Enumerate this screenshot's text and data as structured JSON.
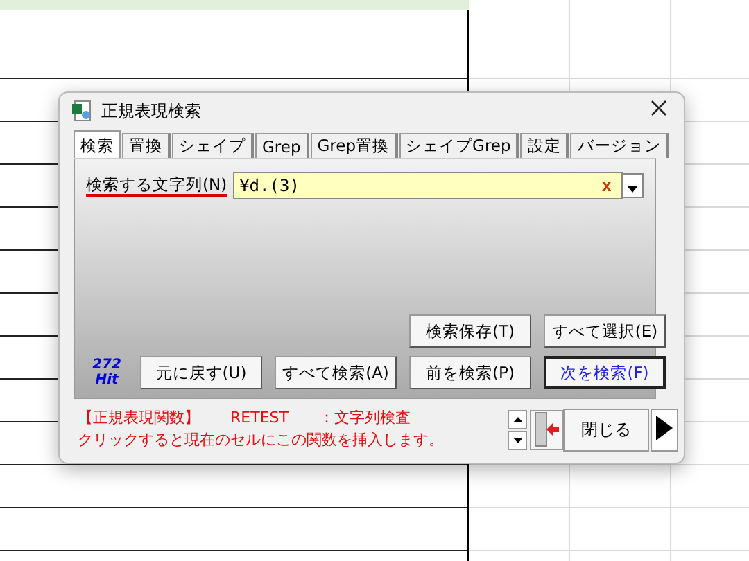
{
  "window": {
    "title": "正規表現検索"
  },
  "tabs": [
    {
      "label": "検索",
      "selected": true
    },
    {
      "label": "置換",
      "selected": false
    },
    {
      "label": "シェイプ",
      "selected": false
    },
    {
      "label": "Grep",
      "selected": false
    },
    {
      "label": "Grep置換",
      "selected": false
    },
    {
      "label": "シェイプGrep",
      "selected": false
    },
    {
      "label": "設定",
      "selected": false
    },
    {
      "label": "バージョン",
      "selected": false
    }
  ],
  "search": {
    "label": "検索する文字列(N)",
    "value": "¥d.(3)",
    "clear": "x"
  },
  "hits": {
    "count": "272",
    "unit": "Hit"
  },
  "buttons_top": [
    {
      "label": "検索保存(T)",
      "default": false
    },
    {
      "label": "すべて選択(E)",
      "default": false
    }
  ],
  "buttons_bottom": [
    {
      "label": "元に戻す(U)",
      "default": false
    },
    {
      "label": "すべて検索(A)",
      "default": false
    },
    {
      "label": "前を検索(P)",
      "default": false
    },
    {
      "label": "次を検索(F)",
      "default": true
    }
  ],
  "function_info": {
    "line1": [
      "【正規表現関数】",
      "RETEST",
      "：文字列検査"
    ],
    "line2": "クリックすると現在のセルにこの関数を挿入します。"
  },
  "close_button": "閉じる"
}
